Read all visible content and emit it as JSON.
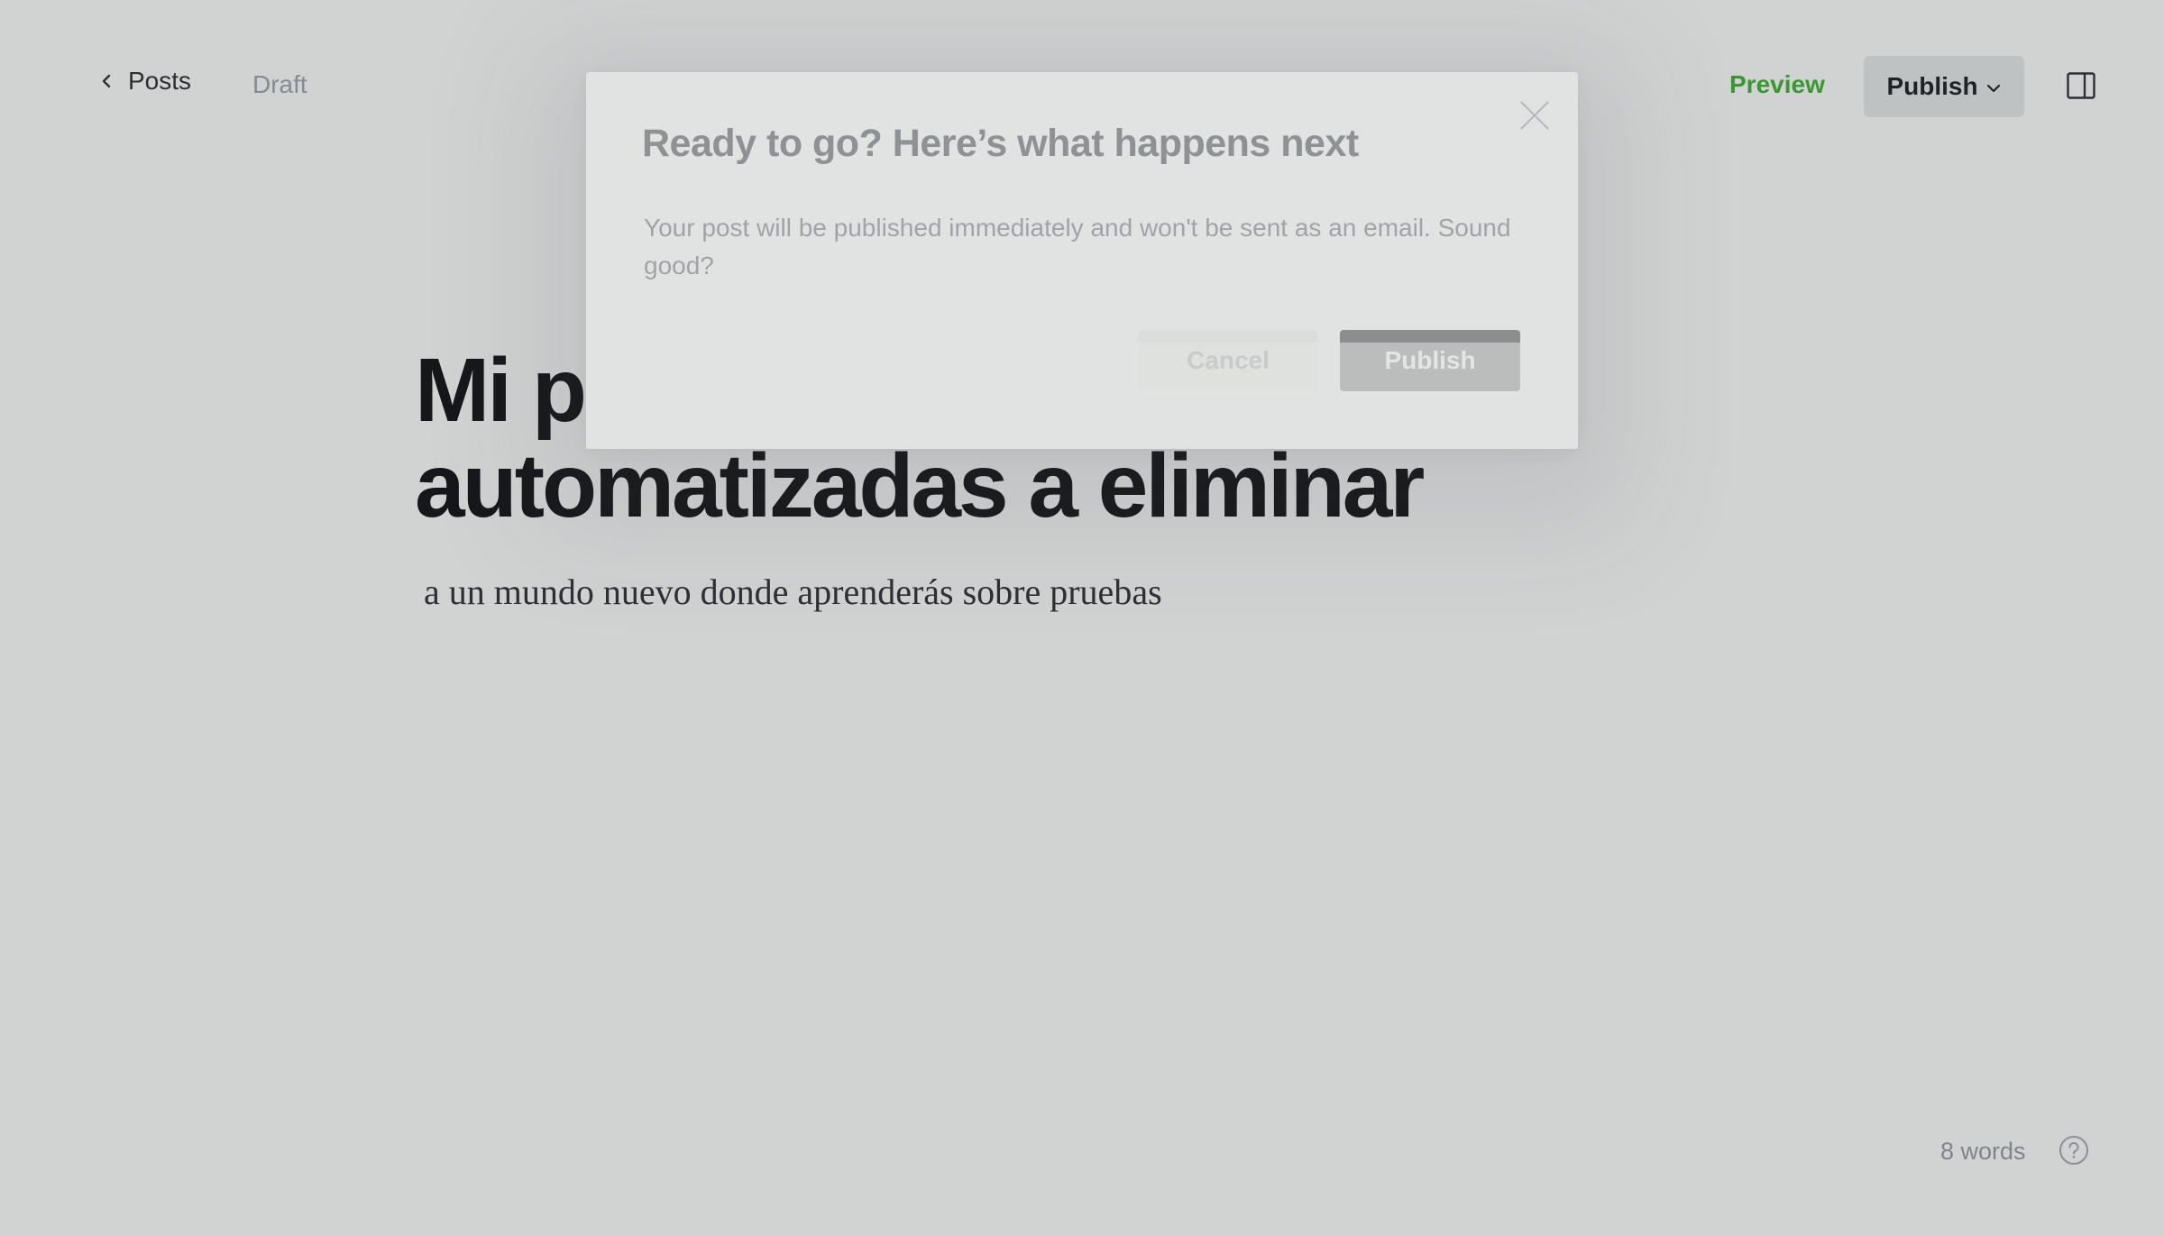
{
  "header": {
    "back_label": "Posts",
    "status": "Draft",
    "preview_label": "Preview",
    "publish_label": "Publish"
  },
  "editor": {
    "title": "Mi primer blog de pruebas automatizadas a eliminar",
    "excerpt": "a un mundo nuevo donde aprenderás sobre pruebas"
  },
  "footer": {
    "word_count": "8 words"
  },
  "modal": {
    "title": "Ready to go? Here’s what happens next",
    "body": "Your post will be published immediately and won't be sent as an email. Sound good?",
    "cancel_label": "Cancel",
    "confirm_label": "Publish"
  },
  "colors": {
    "background": "#d1d3d3",
    "accent_green": "#3b9732",
    "modal_background": "#e1e3e2"
  }
}
